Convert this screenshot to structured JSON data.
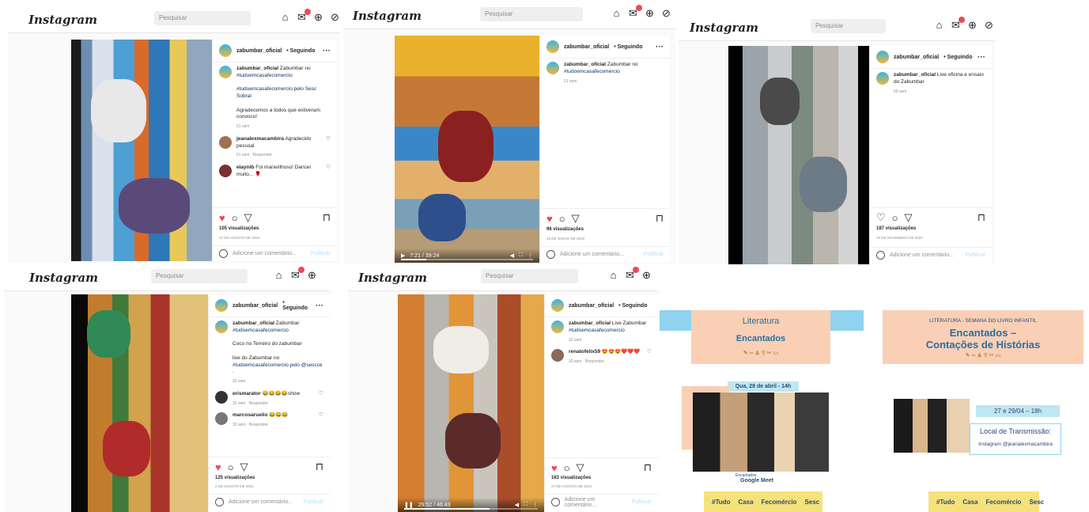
{
  "header": {
    "logo": "Instagram",
    "search_placeholder": "Pesquisar"
  },
  "icons": [
    "home-icon",
    "messenger-icon",
    "new-post-icon",
    "explore-icon"
  ],
  "colors": {
    "like": "#ed4956",
    "link": "#00376b",
    "publish": "#b2dffc",
    "poster_blue": "#8fd3ee",
    "poster_peach": "#f9cfb6"
  },
  "posts": [
    {
      "user": "zabumbar_oficial",
      "follow": "• Seguindo",
      "caption": [
        "Zabumbar no",
        "#tudoemcasafecomercio",
        "#tudoemcasafecomercio pelo Sesc Sobral",
        "Agradecemos a todos que estiveram conosco!"
      ],
      "caption_time": "51 sem",
      "comments": [
        {
          "user": "jeanalexmacambira",
          "text": "Agradecido pessoal",
          "time": "51 sem",
          "reply": "Responder"
        },
        {
          "user": "elaynib",
          "text": "Foi maravilhoso! Dancei muito... 🌹"
        }
      ],
      "views": "105 visualizações",
      "date": "27 DE AGOSTO DE 2020",
      "add_comment": "Adicione um comentário...",
      "publish": "Publicar"
    },
    {
      "user": "zabumbar_oficial",
      "follow": "• Seguindo",
      "caption": [
        "Zabumbar no",
        "#tudoemcasafecomercio"
      ],
      "caption_time": "51 sem",
      "views": "96 visualizações",
      "date": "18 DE JUNHO DE 2020",
      "time": "7:21 / 39:24",
      "progress": 0.19,
      "add_comment": "Adicione um comentário...",
      "publish": "Publicar"
    },
    {
      "user": "zabumbar_oficial",
      "follow": "• Seguindo",
      "caption": [
        "Live oficina e ensaio",
        "do Zabumbar"
      ],
      "caption_time": "50 sem",
      "views": "187 visualizações",
      "date": "16 DE NOVEMBRO DE 2020",
      "add_comment": "Adicione um comentário...",
      "publish": "Publicar"
    },
    {
      "user": "zabumbar_oficial",
      "follow": "• Seguindo",
      "caption": [
        "Zabumbar",
        "#tudoemcasafecomercio",
        "Coco no Terreiro do zabumbar",
        "live do Zabumbar no",
        "#tudoemcasafecomercio pelo @sescce ."
      ],
      "caption_time": "32 sem",
      "comments": [
        {
          "user": "erismarator",
          "text": "😂😂😂😂show",
          "time": "32 sem",
          "reply": "Responder"
        },
        {
          "user": "marcosaruelio",
          "text": "😂😂😂",
          "time": "32 sem",
          "reply": "Responder"
        }
      ],
      "views": "125 visualizações",
      "date": "2 DE AGOSTO DE 2021",
      "add_comment": "Adicione um comentário...",
      "publish": "Publicar"
    },
    {
      "user": "zabumbar_oficial",
      "follow": "• Seguindo",
      "caption": [
        "Live Zabumbar",
        "#tudoemcasafecomercio"
      ],
      "caption_time": "32 sem",
      "comments": [
        {
          "user": "renatofelix59",
          "text": "😍😍😍❤️❤️❤️",
          "time": "33 sem",
          "reply": "Responder"
        }
      ],
      "views": "163 visualizações",
      "date": "27 DE AGOSTO DE 2021",
      "time": "29:52 / 46:43",
      "progress": 0.64,
      "add_comment": "Adicione um comentário...",
      "publish": "Publicar"
    }
  ],
  "posters": [
    {
      "title1": "Literatura",
      "title2": "Encantados",
      "when": "Qua, 28 de abril - 14h",
      "caption": "Encantados",
      "platform": "Google Meet",
      "logos": [
        "#Tudo",
        "Casa",
        "Fecomércio",
        "Sesc"
      ]
    },
    {
      "title1": "LITERATURA - SEMANA DO LIVRO INFANTIL",
      "title2": "Encantados –",
      "title3": "Contações de Histórias",
      "when": "27 e 29/04 – 18h",
      "where": "Local de Transmissão:",
      "platform": "Instagram @jeanalexmacambira",
      "logos": [
        "#Tudo",
        "Casa",
        "Fecomércio",
        "Sesc"
      ]
    }
  ]
}
